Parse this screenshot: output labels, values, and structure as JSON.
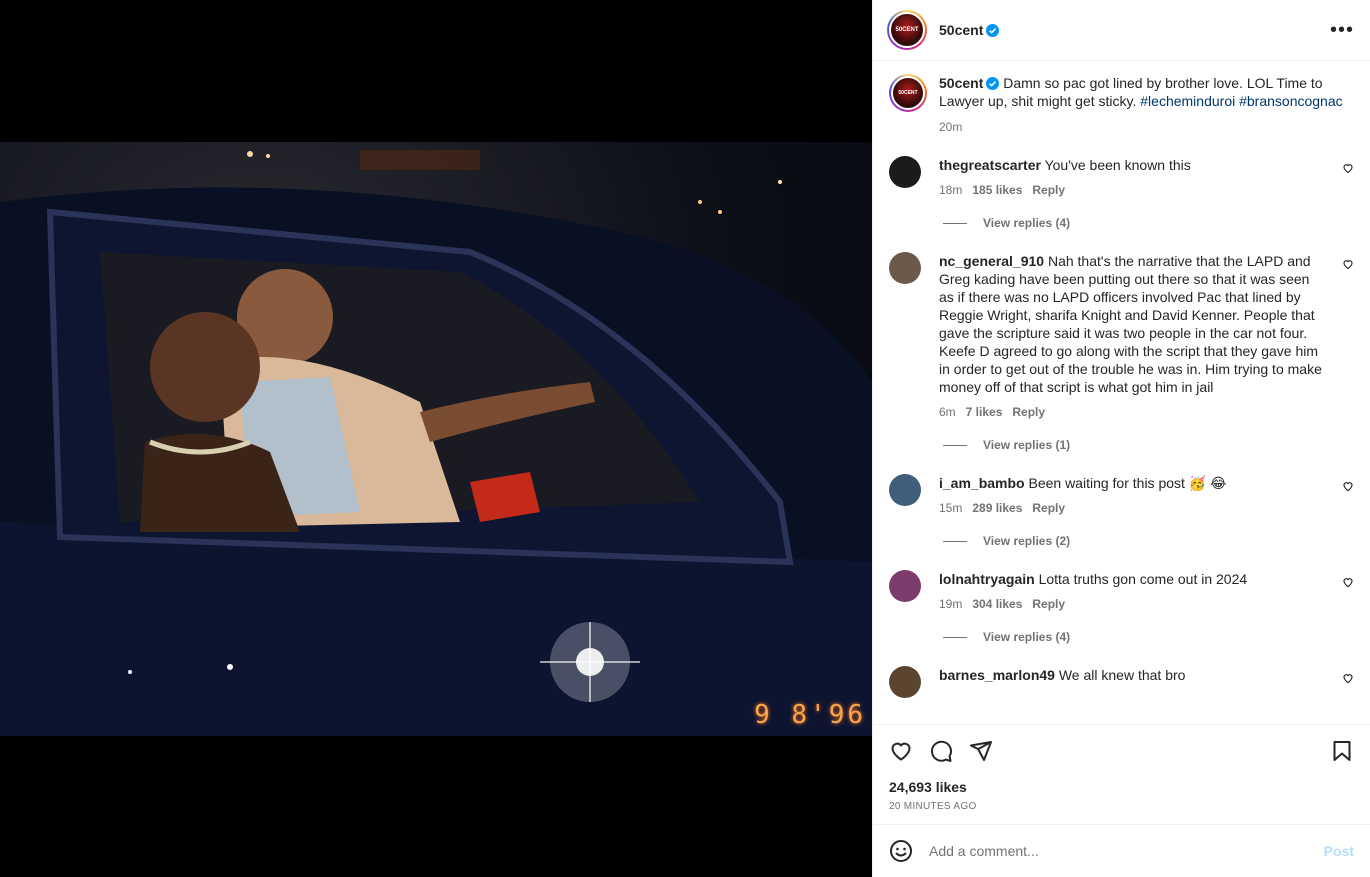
{
  "photo": {
    "date_stamp": "9 8'96",
    "stamp_color": "#f7a64c"
  },
  "header": {
    "username": "50cent",
    "avatar_text": "50CENT",
    "more_icon": "more-horizontal-icon"
  },
  "caption": {
    "username": "50cent",
    "text": "Damn so pac got lined by brother love. LOL Time to Lawyer up, shit might get sticky.",
    "hashtags": [
      "#lecheminduroi",
      "#bransoncognac"
    ],
    "time": "20m"
  },
  "comments": [
    {
      "username": "thegreatscarter",
      "text": "You've been known this",
      "time": "18m",
      "likes": "185 likes",
      "reply": "Reply",
      "view_replies": "View replies (4)",
      "avatar_color": "#1b1b1b"
    },
    {
      "username": "nc_general_910",
      "text": "Nah that's the narrative that the LAPD and Greg kading have been putting out there so that it was seen as if there was no LAPD officers involved Pac that lined by Reggie Wright, sharifa Knight and David Kenner. People that gave the scripture said it was two people in the car not four. Keefe D agreed to go along with the script that they gave him in order to get out of the trouble he was in. Him trying to make money off of that script is what got him in jail",
      "time": "6m",
      "likes": "7 likes",
      "reply": "Reply",
      "view_replies": "View replies (1)",
      "avatar_color": "#6b5a4a"
    },
    {
      "username": "i_am_bambo",
      "text": "Been waiting for this post 🥳 😂",
      "time": "15m",
      "likes": "289 likes",
      "reply": "Reply",
      "view_replies": "View replies (2)",
      "avatar_color": "#3f5e7a"
    },
    {
      "username": "lolnahtryagain",
      "text": "Lotta truths gon come out in 2024",
      "time": "19m",
      "likes": "304 likes",
      "reply": "Reply",
      "view_replies": "View replies (4)",
      "avatar_color": "#7b3b6b"
    },
    {
      "username": "barnes_marlon49",
      "text": "We all knew that bro",
      "time": "",
      "likes": "",
      "reply": "",
      "view_replies": "",
      "avatar_color": "#5a4630"
    }
  ],
  "actions": {
    "likes": "24,693 likes",
    "post_time": "20 MINUTES AGO"
  },
  "comment_box": {
    "placeholder": "Add a comment...",
    "post_label": "Post",
    "post_color": "#b2dffc"
  }
}
